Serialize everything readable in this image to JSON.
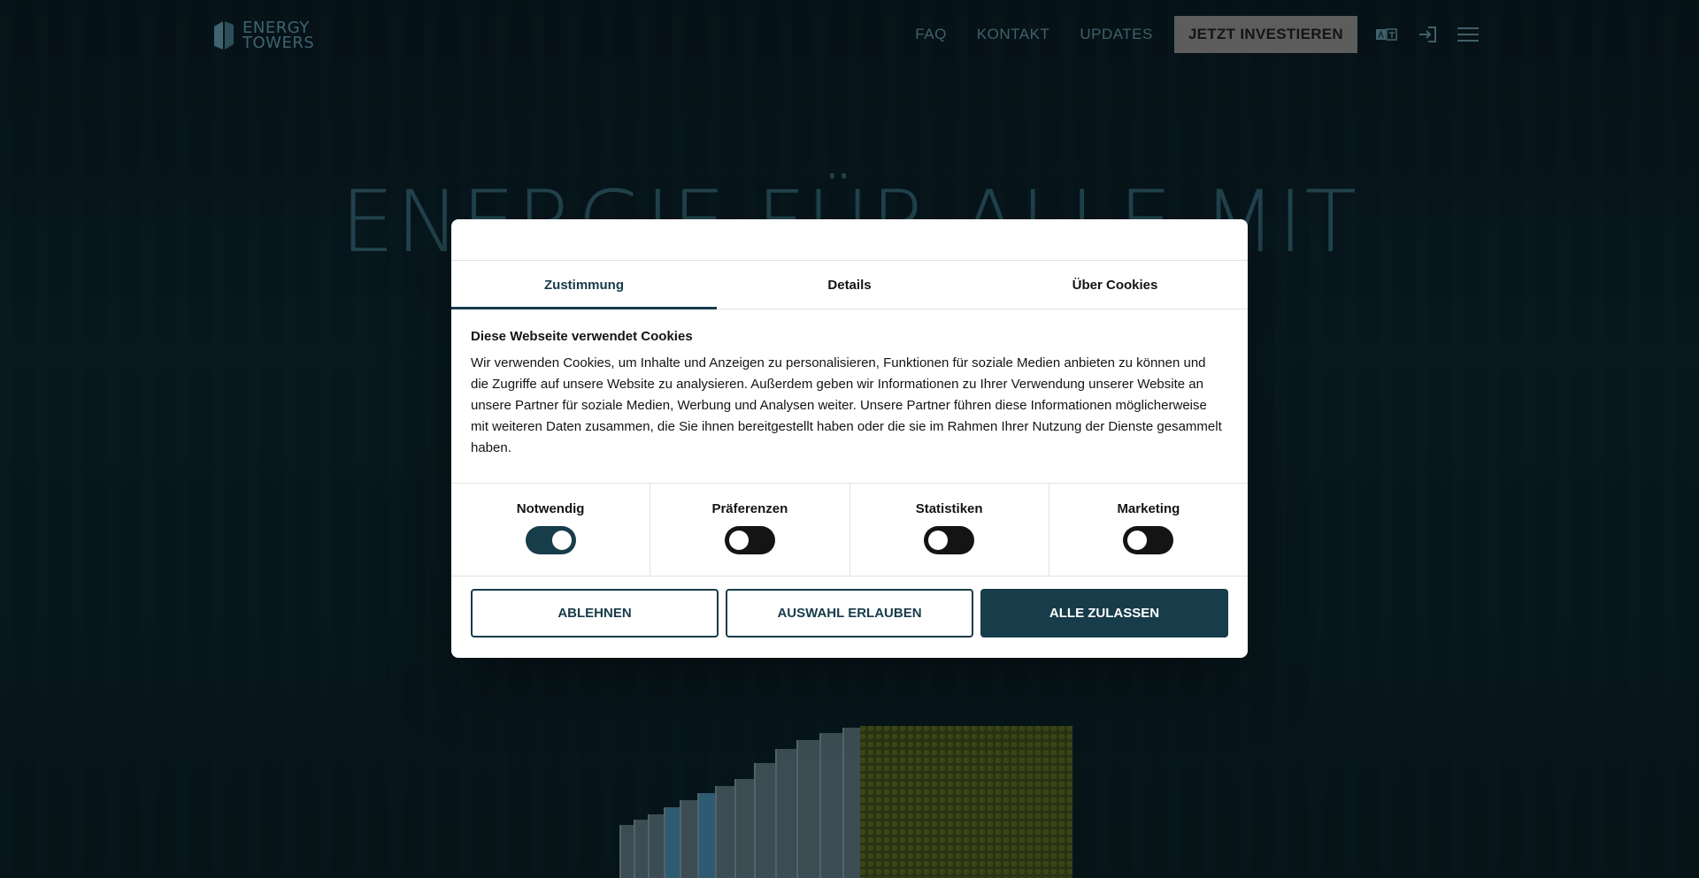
{
  "site": {
    "logo": {
      "line1": "ENERGY",
      "line2": "TOWERS"
    },
    "nav": {
      "faq": "FAQ",
      "contact": "KONTAKT",
      "updates": "UPDATES",
      "invest": "JETZT INVESTIEREN"
    },
    "hero_title": "ENERGIE FÜR ALLE MIT"
  },
  "cookie_dialog": {
    "tabs": [
      "Zustimmung",
      "Details",
      "Über Cookies"
    ],
    "active_tab": "Zustimmung",
    "heading": "Diese Webseite verwendet Cookies",
    "body": "Wir verwenden Cookies, um Inhalte und Anzeigen zu personalisieren, Funktionen für soziale Medien anbieten zu können und die Zugriffe auf unsere Website zu analysieren. Außerdem geben wir Informationen zu Ihrer Verwendung unserer Website an unsere Partner für soziale Medien, Werbung und Analysen weiter. Unsere Partner führen diese Informationen möglicherweise mit weiteren Daten zusammen, die Sie ihnen bereitgestellt haben oder die sie im Rahmen Ihrer Nutzung der Dienste gesammelt haben.",
    "categories": [
      {
        "label": "Notwendig",
        "enabled": true
      },
      {
        "label": "Präferenzen",
        "enabled": false
      },
      {
        "label": "Statistiken",
        "enabled": false
      },
      {
        "label": "Marketing",
        "enabled": false
      }
    ],
    "buttons": {
      "decline": "ABLEHNEN",
      "allow_selection": "AUSWAHL ERLAUBEN",
      "allow_all": "ALLE ZULASSEN"
    }
  },
  "colors": {
    "accent": "#173c4a",
    "toggle_off": "#141414",
    "invest_button": "#5d5d5d"
  },
  "icons": [
    "logo-icon",
    "translate-icon",
    "login-icon",
    "menu-icon"
  ]
}
